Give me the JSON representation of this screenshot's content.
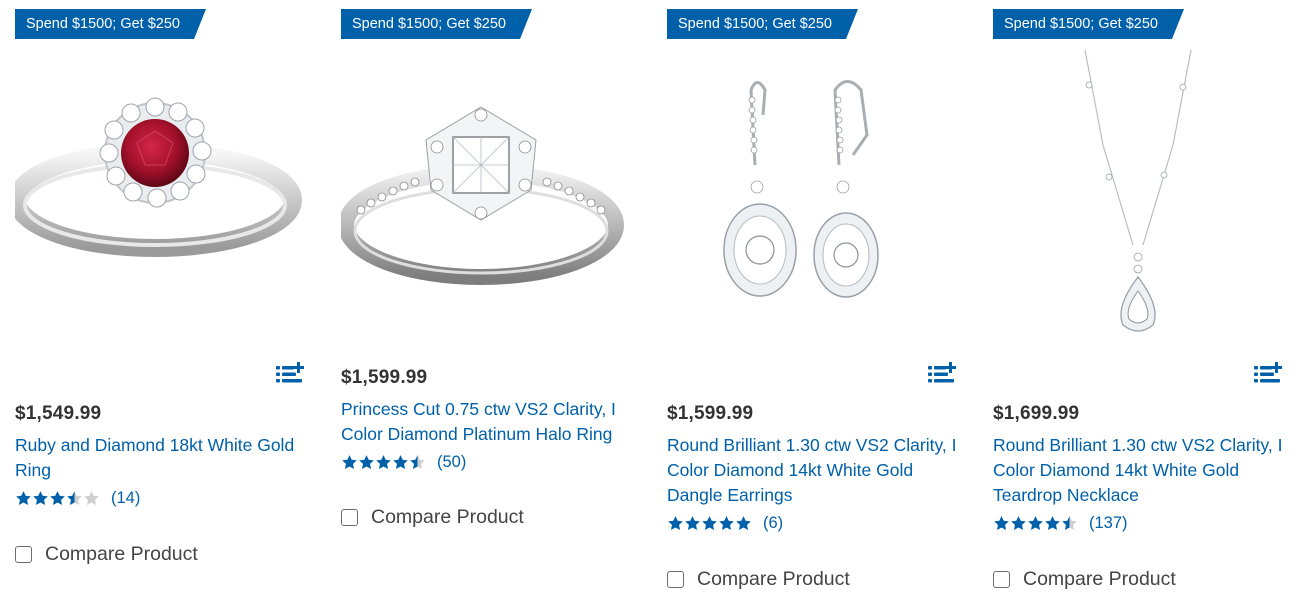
{
  "colors": {
    "accent": "#0060a9",
    "price": "#333333",
    "star_empty": "#cfcfcf"
  },
  "products": [
    {
      "promo": "Spend $1500; Get $250",
      "price": "$1,549.99",
      "title": "Ruby and Diamond 18kt White Gold Ring",
      "rating": 3.5,
      "rating_max": 5,
      "reviews": "(14)",
      "compare_label": "Compare Product",
      "image_icon": "ruby-halo-ring"
    },
    {
      "promo": "Spend $1500; Get $250",
      "price": "$1,599.99",
      "title": "Princess Cut 0.75 ctw VS2 Clarity, I Color Diamond Platinum Halo Ring",
      "rating": 4.5,
      "rating_max": 5,
      "reviews": "(50)",
      "compare_label": "Compare Product",
      "image_icon": "princess-cut-ring"
    },
    {
      "promo": "Spend $1500; Get $250",
      "price": "$1,599.99",
      "title": "Round Brilliant 1.30 ctw VS2 Clarity, I Color Diamond 14kt White Gold Dangle Earrings",
      "rating": 5,
      "rating_max": 5,
      "reviews": "(6)",
      "compare_label": "Compare Product",
      "image_icon": "dangle-earrings"
    },
    {
      "promo": "Spend $1500; Get $250",
      "price": "$1,699.99",
      "title": "Round Brilliant 1.30 ctw VS2 Clarity, I Color Diamond 14kt White Gold Teardrop Necklace",
      "rating": 4.5,
      "rating_max": 5,
      "reviews": "(137)",
      "compare_label": "Compare Product",
      "image_icon": "teardrop-necklace"
    }
  ]
}
